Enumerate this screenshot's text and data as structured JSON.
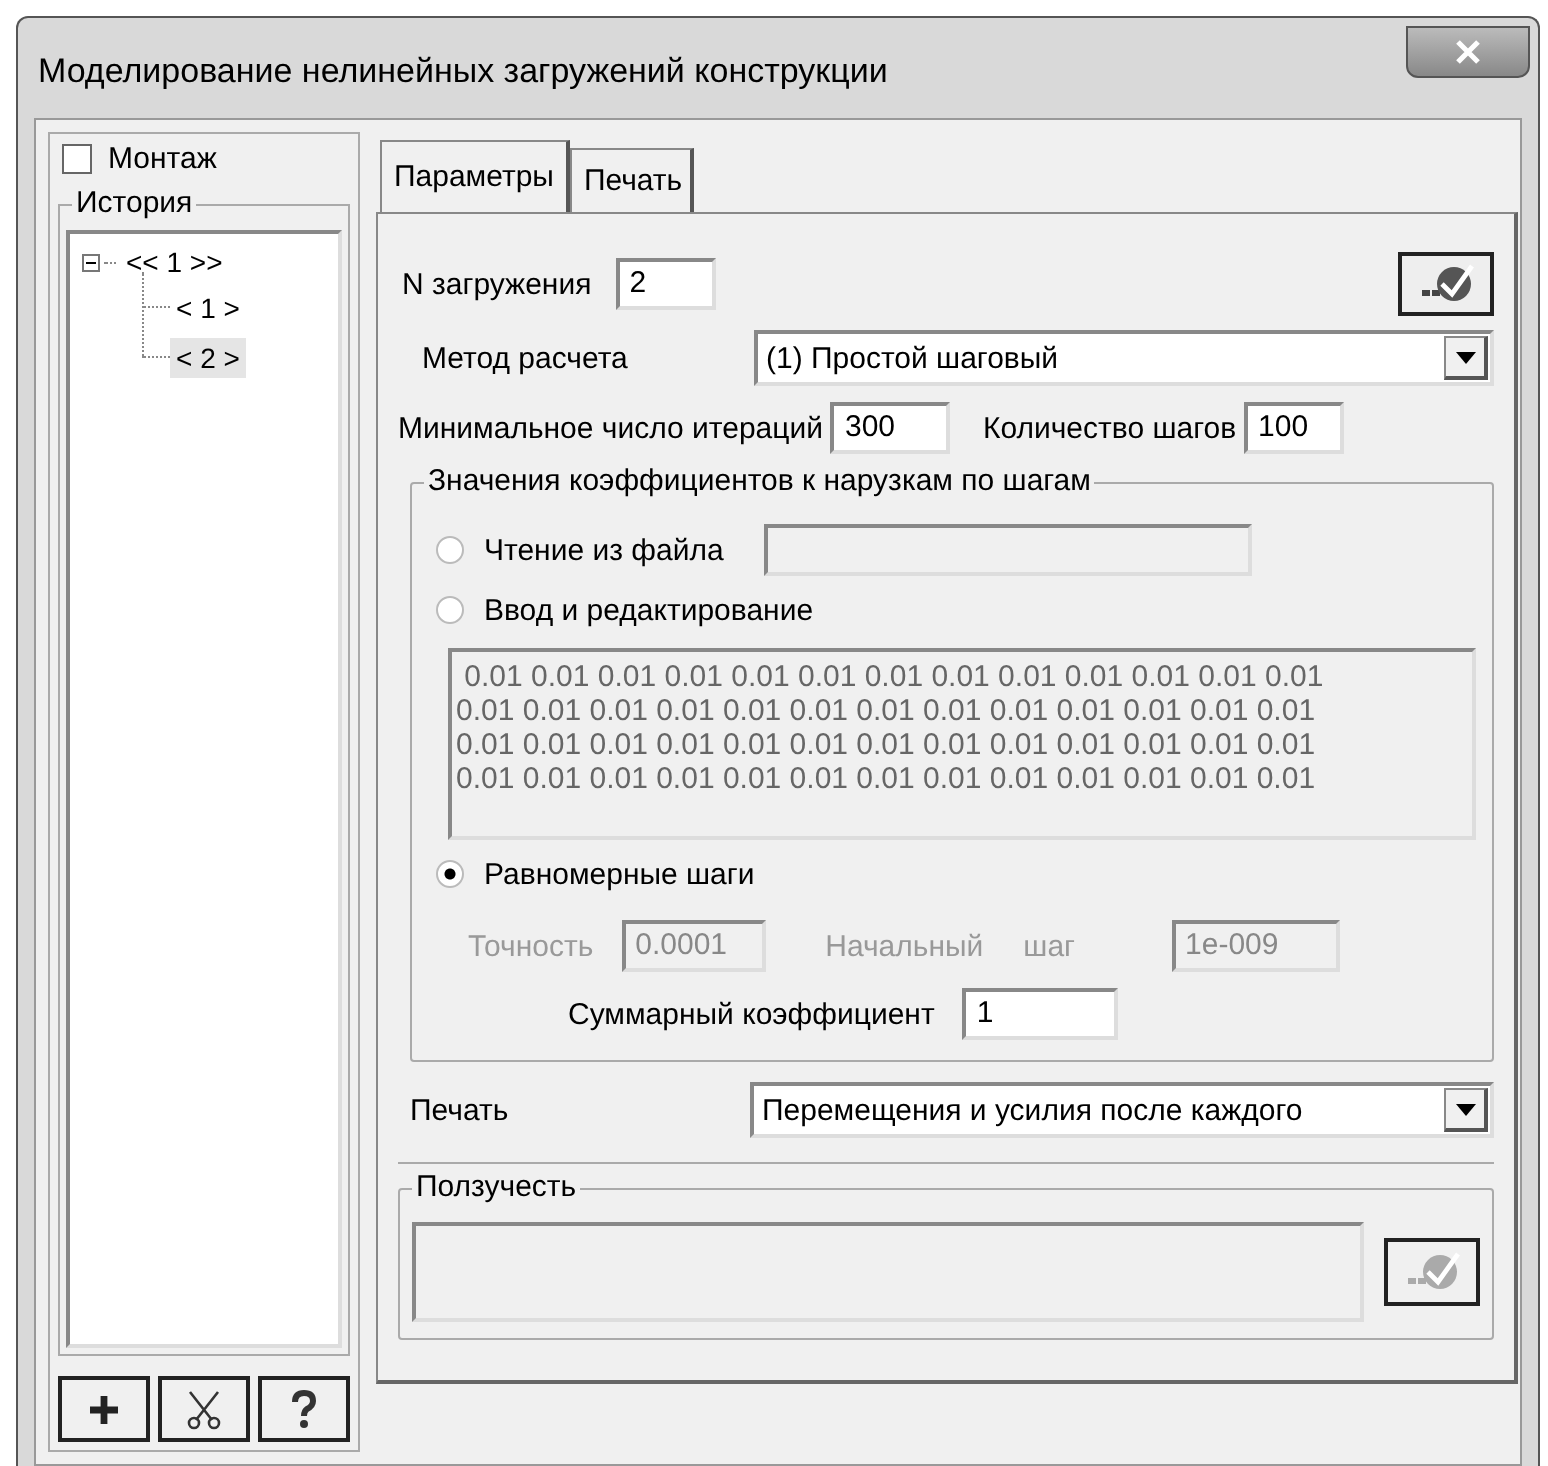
{
  "window": {
    "title": "Моделирование нелинейных загружений конструкции"
  },
  "mount": {
    "label": "Монтаж",
    "checked": false
  },
  "history": {
    "title": "История",
    "tree": [
      {
        "label": "<< 1 >>",
        "expanded": true,
        "selected": false,
        "children": [
          {
            "label": "< 1 >",
            "selected": false
          },
          {
            "label": "< 2 >",
            "selected": true
          }
        ]
      }
    ]
  },
  "tabs": [
    {
      "label": "Параметры",
      "selected": true
    },
    {
      "label": "Печать",
      "selected": false
    }
  ],
  "load_number": {
    "label": "N загружения",
    "value": "2"
  },
  "method": {
    "label": "Метод расчета",
    "value": "(1) Простой шаговый"
  },
  "min_iterations": {
    "label": "Минимальное число итераций",
    "value": "300"
  },
  "step_count": {
    "label": "Количество шагов",
    "value": "100"
  },
  "coefficients": {
    "title": "Значения коэффициентов к нарузкам по шагам",
    "options": [
      {
        "label": "Чтение из файла",
        "selected": false
      },
      {
        "label": "Ввод и редактирование",
        "selected": false
      },
      {
        "label": "Равномерные шаги",
        "selected": true
      }
    ],
    "file_field": {
      "disabled": true
    },
    "values": {
      "disabled": true,
      "lines": [
        " 0.01 0.01 0.01 0.01 0.01 0.01 0.01 0.01 0.01 0.01 0.01 0.01 0.01",
        "0.01 0.01 0.01 0.01 0.01 0.01 0.01 0.01 0.01 0.01 0.01 0.01 0.01",
        "0.01 0.01 0.01 0.01 0.01 0.01 0.01 0.01 0.01 0.01 0.01 0.01 0.01",
        "0.01 0.01 0.01 0.01 0.01 0.01 0.01 0.01 0.01 0.01 0.01 0.01 0.01"
      ]
    },
    "precision": {
      "label": "Точность",
      "value": "0.0001",
      "disabled": true
    },
    "initial_step": {
      "label": "Начальный",
      "label_2": "шаг",
      "value": "1e-009",
      "disabled": true
    },
    "total": {
      "label": "Суммарный коэффициент",
      "value": "1"
    }
  },
  "print": {
    "label": "Печать",
    "value": "Перемещения и усилия после каждого"
  },
  "creep": {
    "title": "Ползучесть"
  }
}
